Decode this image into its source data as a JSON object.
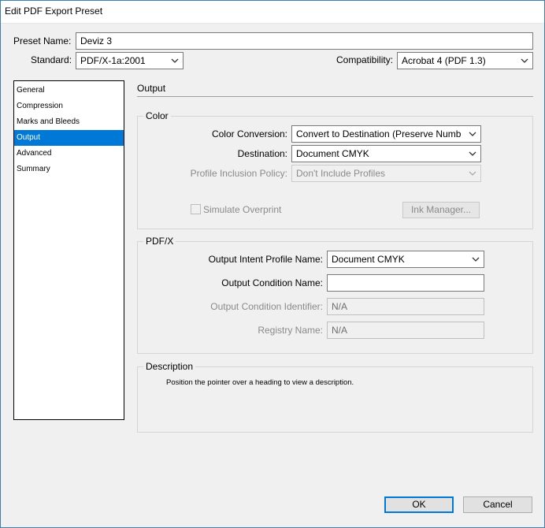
{
  "window": {
    "title": "Edit PDF Export Preset"
  },
  "preset": {
    "label": "Preset Name:",
    "value": "Deviz 3"
  },
  "standard": {
    "label": "Standard:",
    "value": "PDF/X-1a:2001"
  },
  "compatibility": {
    "label": "Compatibility:",
    "value": "Acrobat 4 (PDF 1.3)"
  },
  "sidebar": {
    "items": [
      {
        "label": "General"
      },
      {
        "label": "Compression"
      },
      {
        "label": "Marks and Bleeds"
      },
      {
        "label": "Output"
      },
      {
        "label": "Advanced"
      },
      {
        "label": "Summary"
      }
    ],
    "selected": "Output",
    "selected_color": "#0078d7"
  },
  "main": {
    "title": "Output"
  },
  "color": {
    "title": "Color",
    "conversion_label": "Color Conversion:",
    "conversion_value": "Convert to Destination (Preserve Numb",
    "destination_label": "Destination:",
    "destination_value": "Document CMYK",
    "profile_label": "Profile Inclusion Policy:",
    "profile_value": "Don't Include Profiles",
    "simulate_label": "Simulate Overprint",
    "ink_manager_label": "Ink Manager..."
  },
  "pdfx": {
    "title": "PDF/X",
    "intent_label": "Output Intent Profile Name:",
    "intent_value": "Document CMYK",
    "condition_name_label": "Output Condition Name:",
    "condition_name_value": "",
    "condition_id_label": "Output Condition Identifier:",
    "condition_id_value": "N/A",
    "registry_label": "Registry Name:",
    "registry_value": "N/A"
  },
  "description": {
    "title": "Description",
    "text": "Position the pointer over a heading to view a description."
  },
  "buttons": {
    "ok": "OK",
    "cancel": "Cancel"
  }
}
